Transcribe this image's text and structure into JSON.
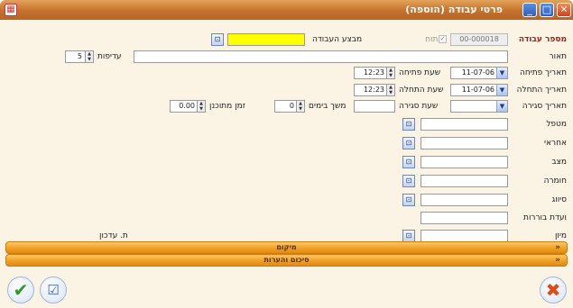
{
  "window": {
    "title": "פרטי עבודה (הוספה)",
    "icon": "app-icon",
    "buttons": {
      "minimize": "_",
      "maximize": "□",
      "close": "✕"
    }
  },
  "form": {
    "job_number_label": "מספר עבודה",
    "job_number_value": "00-000018",
    "open_label": "פתוח",
    "performer_label": "מבצע העבודה",
    "performer_value": "",
    "description_label": "תאור",
    "description_value": "",
    "priority_label": "עדיפות",
    "priority_value": "5",
    "open_date_label": "תאריך פתיחה",
    "open_date_value": "11-07-06",
    "open_time_label": "שעת פתיחה",
    "open_time_value": "12:23",
    "start_date_label": "תאריך התחלה",
    "start_date_value": "11-07-06",
    "start_time_label": "שעת התחלה",
    "start_time_value": "12:23",
    "close_date_label": "תאריך סגירה",
    "close_date_value": "",
    "close_time_label": "שעת סגירה",
    "close_time_value": "",
    "duration_label": "משך בימים",
    "duration_value": "0",
    "planned_time_label": "זמן מתוכנן",
    "planned_time_value": "0.00",
    "handler_label": "מטפל",
    "responsible_label": "אחראי",
    "status_label": "מצב",
    "severity_label": "חומרה",
    "classification_label": "סיווג",
    "committee_label": "ועדת בוררות",
    "sort_label": "מיון",
    "update_date_label": "ת. עדכון"
  },
  "sections": {
    "location": "מיקום",
    "summary": "סיכום והערות"
  },
  "footer": {
    "confirm": "confirm-icon",
    "confirm_and_continue": "confirm-continue-icon",
    "cancel": "cancel-icon"
  },
  "colors": {
    "title_bar": "#c8742e",
    "form_background": "#fbf3e3",
    "section_bar": "#f1a025",
    "required_label": "#a02020",
    "performer_field": "#ffff00"
  }
}
